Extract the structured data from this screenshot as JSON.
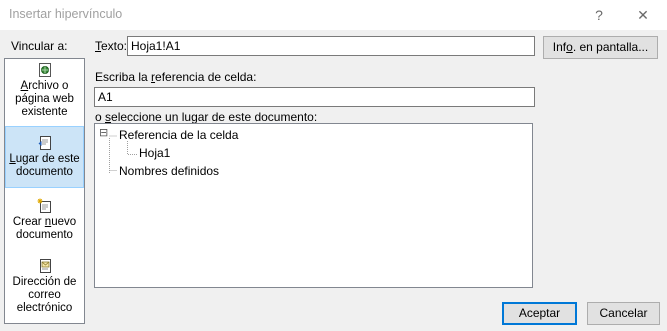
{
  "window": {
    "title": "Insertar hipervínculo",
    "help": "?",
    "close": "✕"
  },
  "link_to": {
    "label": "Vincular a:",
    "items": [
      {
        "line1_pre": "",
        "line1_u": "A",
        "line1_post": "rchivo o",
        "line2": "página web",
        "line3": "existente",
        "icon": "file-web-icon"
      },
      {
        "line1_pre": "",
        "line1_u": "L",
        "line1_post": "ugar de este",
        "line2": "documento",
        "line3": "",
        "icon": "document-place-icon"
      },
      {
        "line1": "Crear ",
        "line1_u": "n",
        "line1_post": "uevo",
        "line2": "documento",
        "icon": "new-document-icon"
      },
      {
        "line1": "Dirección de",
        "line2": "correo",
        "line3": "electrónico",
        "icon": "email-icon"
      }
    ]
  },
  "text_field": {
    "label_u": "T",
    "label_rest": "exto:",
    "value": "Hoja1!A1"
  },
  "screentip_button": {
    "pre": "Inf",
    "u": "o",
    "post": ". en pantalla..."
  },
  "cell_ref": {
    "label_pre": "Escriba la ",
    "label_u": "r",
    "label_post": "eferencia de celda:",
    "value": "A1"
  },
  "place_list": {
    "label_pre": "o ",
    "label_u": "s",
    "label_post": "eleccione un lugar de este documento:",
    "tree": {
      "root1": "Referencia de la celda",
      "child1": "Hoja1",
      "root2": "Nombres definidos",
      "expander": "⊟"
    }
  },
  "buttons": {
    "ok": "Aceptar",
    "cancel": "Cancelar"
  }
}
